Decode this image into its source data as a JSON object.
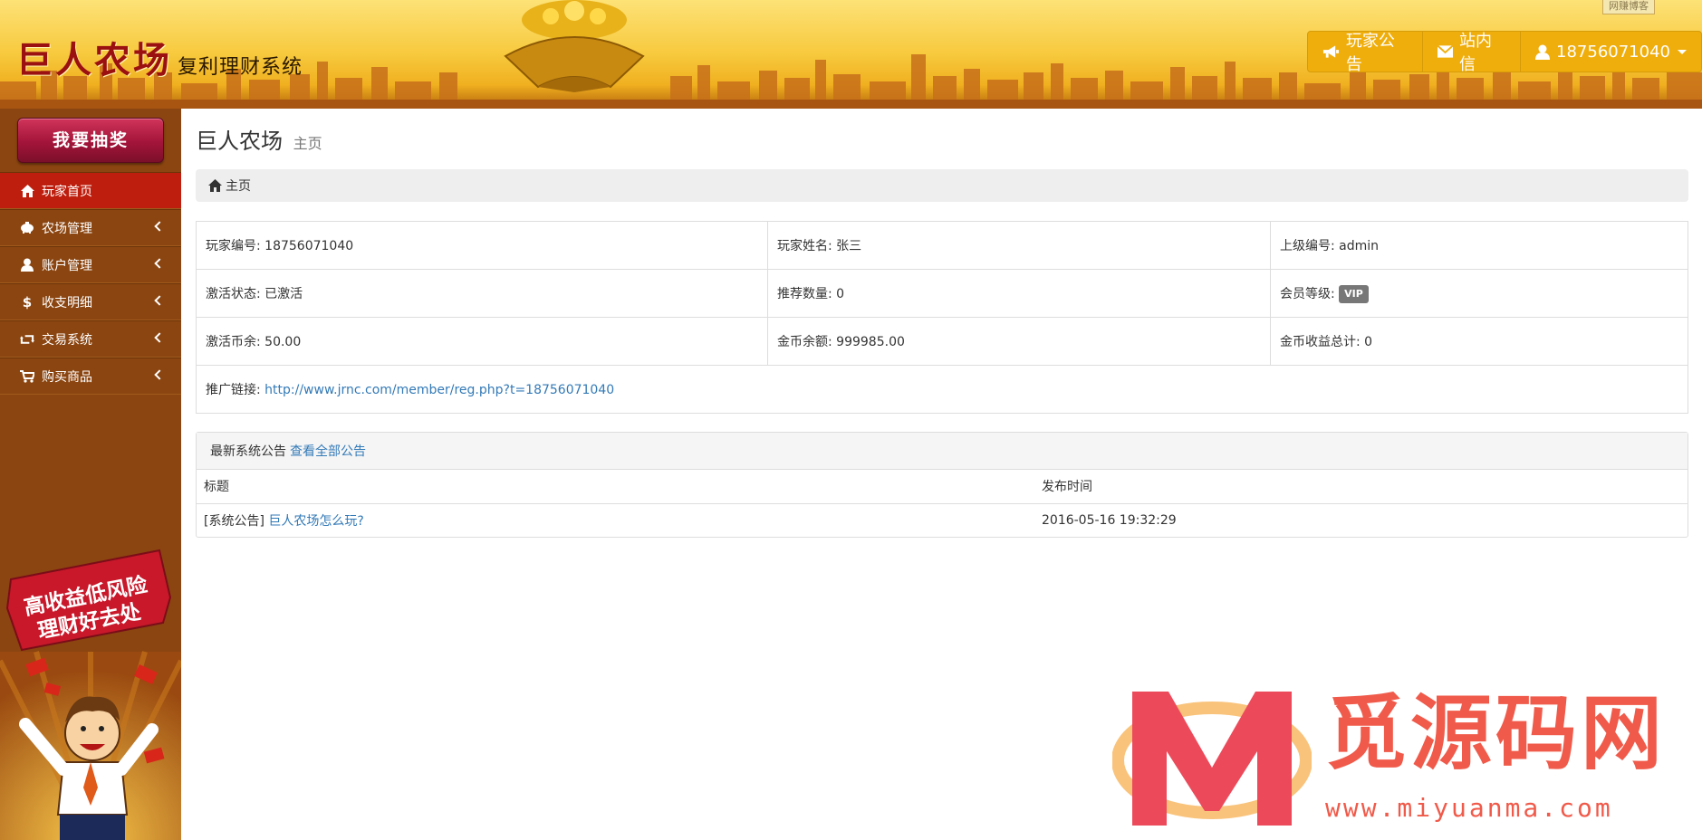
{
  "header": {
    "brand_title": "巨人农场",
    "brand_subtitle": "复利理财系统",
    "corner_tag": "网赚博客",
    "nav": [
      {
        "label": "玩家公告",
        "icon": "bullhorn-icon"
      },
      {
        "label": "站内信",
        "icon": "envelope-icon"
      },
      {
        "label": "18756071040",
        "icon": "user-icon"
      }
    ]
  },
  "sidebar": {
    "lottery_label": "我要抽奖",
    "menu": [
      {
        "label": "玩家首页",
        "icon": "home-icon",
        "active": true
      },
      {
        "label": "农场管理",
        "icon": "piggy-icon"
      },
      {
        "label": "账户管理",
        "icon": "user-icon"
      },
      {
        "label": "收支明细",
        "icon": "dollar-icon"
      },
      {
        "label": "交易系统",
        "icon": "retweet-icon"
      },
      {
        "label": "购买商品",
        "icon": "cart-icon"
      }
    ],
    "promo_text_1": "高收益低风险",
    "promo_text_2": "理财好去处"
  },
  "main": {
    "title": "巨人农场",
    "title_small": "主页",
    "breadcrumb": "主页",
    "info": {
      "player_id_label": "玩家编号:",
      "player_id": "18756071040",
      "player_name_label": "玩家姓名:",
      "player_name": "张三",
      "parent_id_label": "上级编号:",
      "parent_id": "admin",
      "activation_label": "激活状态:",
      "activation": "已激活",
      "referrals_label": "推荐数量:",
      "referrals": "0",
      "level_label": "会员等级:",
      "level": "VIP",
      "activation_coins_label": "激活币余:",
      "activation_coins": "50.00",
      "gold_balance_label": "金币余额:",
      "gold_balance": "999985.00",
      "gold_income_label": "金币收益总计:",
      "gold_income": "0",
      "promo_link_label": "推广链接:",
      "promo_link": "http://www.jrnc.com/member/reg.php?t=18756071040"
    },
    "announcements": {
      "heading": "最新系统公告",
      "view_all": "查看全部公告",
      "col_title": "标题",
      "col_time": "发布时间",
      "rows": [
        {
          "tag": "[系统公告]",
          "title": "巨人农场怎么玩?",
          "time": "2016-05-16 19:32:29"
        }
      ]
    }
  },
  "watermark": {
    "text": "觅源码网",
    "url": "www.miyuanma.com"
  },
  "colors": {
    "header_gold": "#f7c93d",
    "sidebar_brown": "#8b4510",
    "menu_active": "#be1e0d",
    "link_blue": "#337ab7",
    "watermark_red": "#f05a4a"
  }
}
